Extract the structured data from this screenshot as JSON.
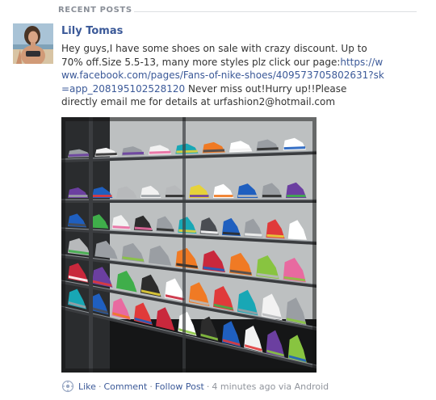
{
  "section": {
    "title": "RECENT POSTS"
  },
  "post": {
    "author": "Lily Tomas",
    "text_before_link": "Hey guys,I have some shoes on sale with crazy discount. Up to 70% off.Size 5.5-13, many more styles plz click our page:",
    "link": "https://www.facebook.com/pages/Fans-of-nike-shoes/409573705802631?sk=app_208195102528120",
    "text_after_link": " Never miss out!Hurry up!!Please directly email me for details at urfashion2@hotmail.com"
  },
  "actions": {
    "like": "Like",
    "comment": "Comment",
    "follow": "Follow Post",
    "separator": "·",
    "timestamp": "4 minutes ago via Android"
  },
  "icons": {
    "post_source": "android-icon"
  },
  "colors": {
    "link": "#3b5998",
    "meta": "#90949c",
    "header": "#8a8f98"
  }
}
